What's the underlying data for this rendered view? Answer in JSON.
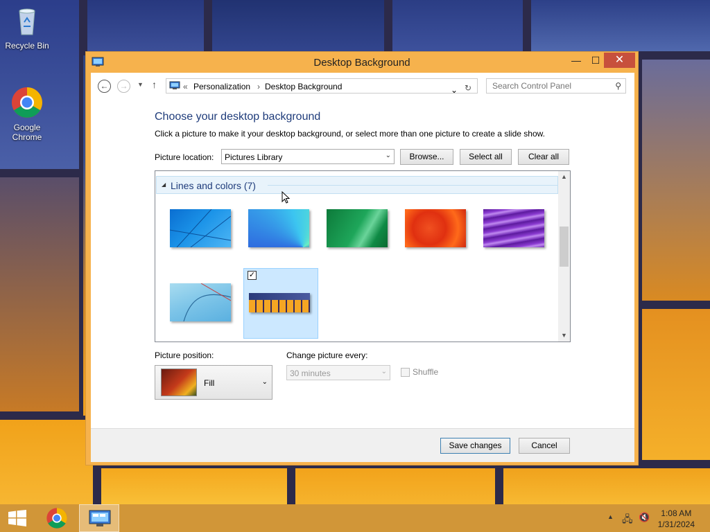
{
  "desktop": {
    "icons": [
      {
        "label": "Recycle Bin"
      },
      {
        "label": "Google\nChrome"
      }
    ]
  },
  "window": {
    "title": "Desktop Background",
    "controls": {
      "minimize": "—",
      "maximize": "☐",
      "close": "✕"
    }
  },
  "nav": {
    "breadcrumb_prefix": "«",
    "breadcrumb": [
      "Personalization",
      "Desktop Background"
    ],
    "separator": "›",
    "search_placeholder": "Search Control Panel"
  },
  "main": {
    "heading": "Choose your desktop background",
    "description": "Click a picture to make it your desktop background, or select more than one picture to create a slide show.",
    "picture_location_label": "Picture location:",
    "picture_location_value": "Pictures Library",
    "browse_label": "Browse...",
    "select_all_label": "Select all",
    "clear_all_label": "Clear all",
    "group_title": "Lines and colors (7)",
    "thumbnails": [
      {
        "name": "blue-lines",
        "selected": false
      },
      {
        "name": "blue-fan",
        "selected": false
      },
      {
        "name": "green-wave",
        "selected": false
      },
      {
        "name": "red-orange",
        "selected": false
      },
      {
        "name": "purple-waves",
        "selected": false
      },
      {
        "name": "light-blue-lines",
        "selected": false
      },
      {
        "name": "orange-windows",
        "selected": true
      }
    ],
    "picture_position_label": "Picture position:",
    "picture_position_value": "Fill",
    "change_picture_label": "Change picture every:",
    "change_picture_value": "30 minutes",
    "shuffle_label": "Shuffle"
  },
  "footer": {
    "save_label": "Save changes",
    "cancel_label": "Cancel"
  },
  "taskbar": {
    "time": "1:08 AM",
    "date": "1/31/2024"
  }
}
